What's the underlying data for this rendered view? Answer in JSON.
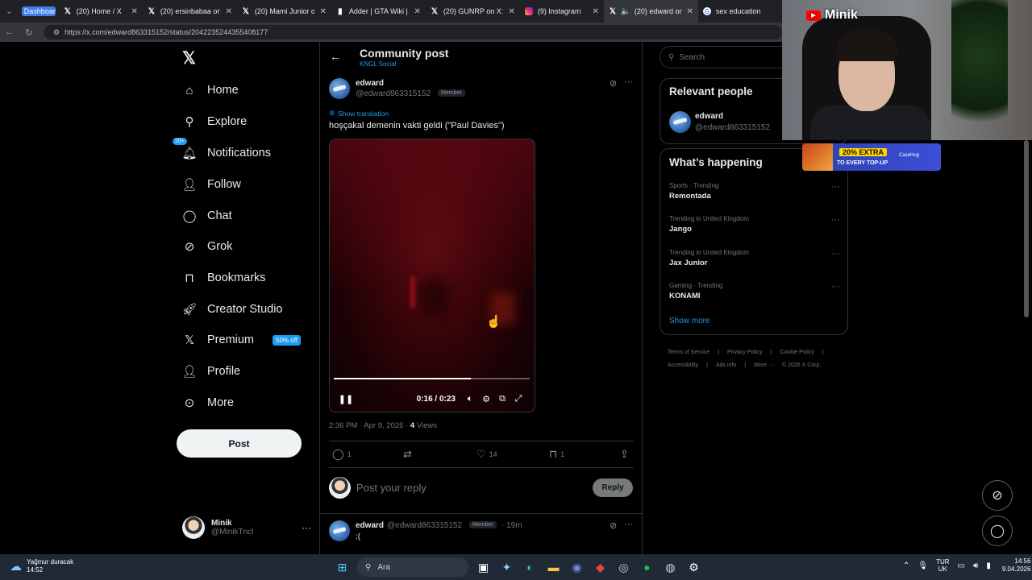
{
  "browser": {
    "tabs": [
      {
        "label": "Dashboard",
        "icon": "dashboard-label"
      },
      {
        "label": "(20) Home / X",
        "icon": "x-icon"
      },
      {
        "label": "(20) ersinbabaa on X: \"S",
        "icon": "x-icon"
      },
      {
        "label": "(20) Mami Junior on X: \"",
        "icon": "x-icon"
      },
      {
        "label": "Adder | GTA Wiki | Fandom",
        "icon": "fandom-icon"
      },
      {
        "label": "(20) GUNRP on X: \"HER",
        "icon": "x-icon"
      },
      {
        "label": "(9) Instagram",
        "icon": "instagram-icon"
      },
      {
        "label": "(20) edward on X: \"",
        "icon": "x-icon"
      },
      {
        "label": "sex education",
        "icon": "google-icon"
      }
    ],
    "url": "https://x.com/edward863315152/status/2042235244355408177"
  },
  "sidebar": {
    "nav": [
      {
        "label": "Home",
        "icon": "home-icon"
      },
      {
        "label": "Explore",
        "icon": "search-icon"
      },
      {
        "label": "Notifications",
        "icon": "bell-icon",
        "badge": "20+"
      },
      {
        "label": "Follow",
        "icon": "follow-icon"
      },
      {
        "label": "Chat",
        "icon": "chat-icon"
      },
      {
        "label": "Grok",
        "icon": "grok-icon"
      },
      {
        "label": "Bookmarks",
        "icon": "bookmark-icon"
      },
      {
        "label": "Creator Studio",
        "icon": "rocket-icon"
      },
      {
        "label": "Premium",
        "icon": "x-icon",
        "promo": "50% off"
      },
      {
        "label": "Profile",
        "icon": "person-icon"
      },
      {
        "label": "More",
        "icon": "more-circle-icon"
      }
    ],
    "post_label": "Post",
    "account": {
      "name": "Minik",
      "handle": "@MinikTncl"
    }
  },
  "header": {
    "title": "Community post",
    "subtitle": "KNGL Social"
  },
  "post": {
    "author": "edward",
    "handle": "@edward863315152",
    "role": "Member",
    "show_translation": "Show translation",
    "text": "hoşçakal demenin vakti geldi (\"Paul Davies\")",
    "video": {
      "time": "0:16 / 0:23",
      "progress_fraction": 0.7
    },
    "timestamp": "2:36 PM · Apr 9, 2026 ·",
    "views_count": "4",
    "views_label": "Views",
    "stats": {
      "replies": "1",
      "reposts": "",
      "likes": "14",
      "bookmarks": "1"
    }
  },
  "reply_box": {
    "placeholder": "Post your reply",
    "button": "Reply"
  },
  "reply": {
    "author": "edward",
    "handle": "@edward863315152",
    "role": "Member",
    "time": "· 19m",
    "text": ":("
  },
  "right": {
    "search_placeholder": "Search",
    "relevant_title": "Relevant people",
    "relevant": {
      "name": "edward",
      "handle": "@edward863315152"
    },
    "happening_title": "What’s happening",
    "trends": [
      {
        "category": "Sports · Trending",
        "name": "Remontada"
      },
      {
        "category": "Trending in United Kingdom",
        "name": "Jango"
      },
      {
        "category": "Trending in United Kingdom",
        "name": "Jax Junior"
      },
      {
        "category": "Gaming · Trending",
        "name": "KONAMI"
      }
    ],
    "show_more": "Show more",
    "footer": [
      "Terms of Service",
      "|",
      "Privacy Policy",
      "|",
      "Cookie Policy",
      "|",
      "Accessibility",
      "|",
      "Ads info",
      "|",
      "More ···",
      "© 2026 X Corp."
    ]
  },
  "overlay": {
    "channel": "Minik",
    "ad_line1": "20% EXTRA",
    "ad_line2": "TO EVERY TOP-UP",
    "ad_brand": "CaseHug"
  },
  "taskbar": {
    "weather": "Yağmur duracak",
    "weather_time": "14:52",
    "search": "Ara",
    "lang1": "TUR",
    "lang2": "UK",
    "time": "14:56",
    "date": "9.04.2026"
  }
}
